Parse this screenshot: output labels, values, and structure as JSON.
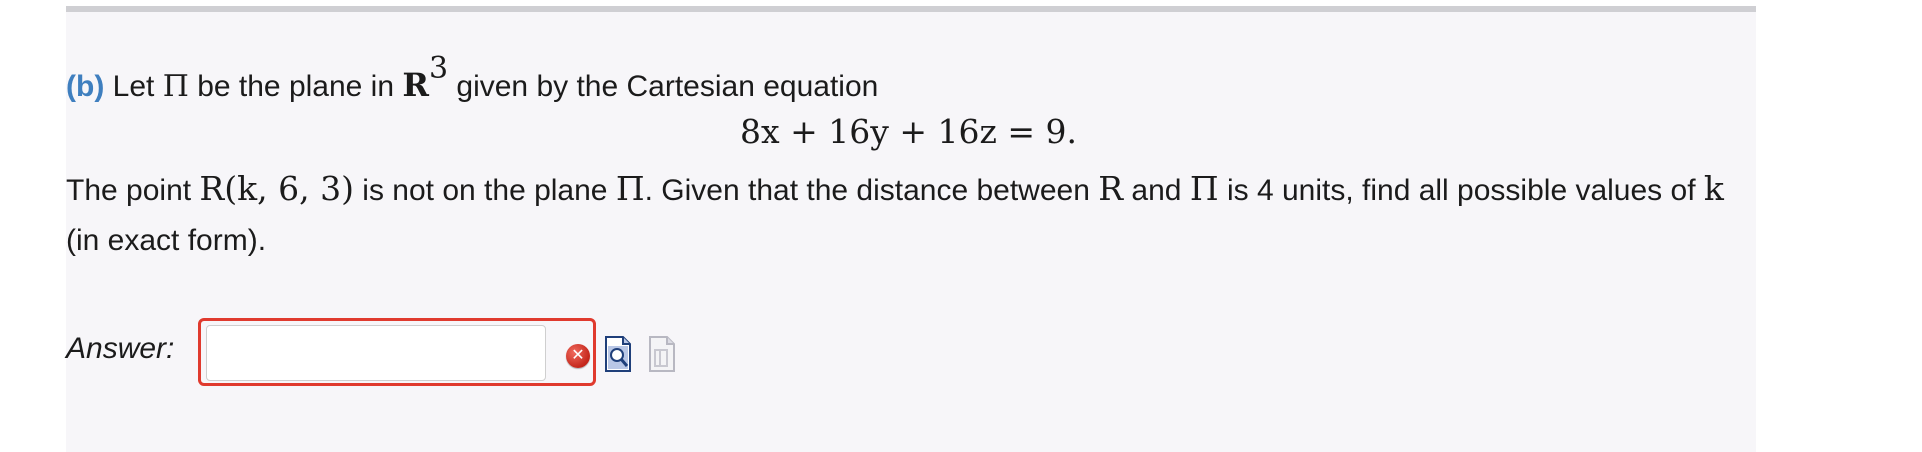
{
  "question": {
    "part_label": "(b)",
    "intro_before": " Let ",
    "pi_symbol": "Π",
    "intro_middle": " be the plane in ",
    "space_symbol": "R",
    "space_exponent": "3",
    "intro_after": " given by the Cartesian equation",
    "equation": "8x + 16y + 16z = 9.",
    "para_text1": "The point ",
    "point": "R(k, 6, 3)",
    "para_text2": " is not on the plane ",
    "para_text3": ". Given that the distance between ",
    "point_name": "R",
    "para_text4": " and ",
    "para_text5": " is 4 units, find all possible values of ",
    "variable": "k",
    "para_text6": " (in exact form)."
  },
  "answer": {
    "label": "Answer:",
    "value": "",
    "placeholder": ""
  },
  "icons": {
    "error": "error-x-icon",
    "preview": "preview-document-icon",
    "help": "help-document-icon",
    "error_color": "#e03a2e"
  }
}
